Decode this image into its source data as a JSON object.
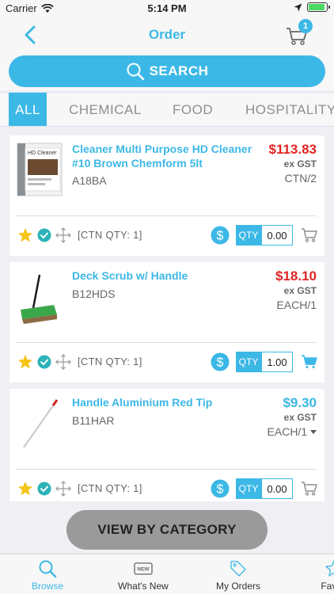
{
  "status_bar": {
    "carrier": "Carrier",
    "time": "5:14 PM",
    "battery_level": 0.9
  },
  "nav": {
    "title": "Order",
    "cart_count": "1"
  },
  "search": {
    "label": "SEARCH"
  },
  "categories": [
    "ALL",
    "CHEMICAL",
    "FOOD",
    "HOSPITALITY"
  ],
  "products": [
    {
      "name": "Cleaner Multi Purpose HD Cleaner #10 Brown Chemform 5lt",
      "code": "A18BA",
      "price": "$113.83",
      "gst": "ex GST",
      "unit": "CTN/2",
      "ctn_qty": "[CTN QTY: 1]",
      "qty_label": "QTY",
      "qty_value": "0.00",
      "thumb_text": "HD Cleaner"
    },
    {
      "name": "Deck Scrub w/ Handle",
      "code": "B12HDS",
      "price": "$18.10",
      "gst": "ex GST",
      "unit": "EACH/1",
      "ctn_qty": "[CTN QTY: 1]",
      "qty_label": "QTY",
      "qty_value": "1.00"
    },
    {
      "name": "Handle Aluminium Red Tip",
      "code": "B11HAR",
      "price": "$9.30",
      "gst": "ex GST",
      "unit": "EACH/1",
      "ctn_qty": "[CTN QTY: 1]",
      "qty_label": "QTY",
      "qty_value": "0.00"
    }
  ],
  "view_by_category": "VIEW BY CATEGORY",
  "tab_bar": [
    {
      "label": "Browse",
      "icon": "search-icon"
    },
    {
      "label": "What's New",
      "icon": "new-tag-icon",
      "icon_text": "NEW"
    },
    {
      "label": "My Orders",
      "icon": "tag-icon"
    },
    {
      "label": "Favou",
      "icon": "star-icon"
    }
  ],
  "colors": {
    "accent": "#3cb8e6",
    "price_red": "#e02424",
    "star_yellow": "#f5c518",
    "check_teal": "#2bb3b8"
  }
}
